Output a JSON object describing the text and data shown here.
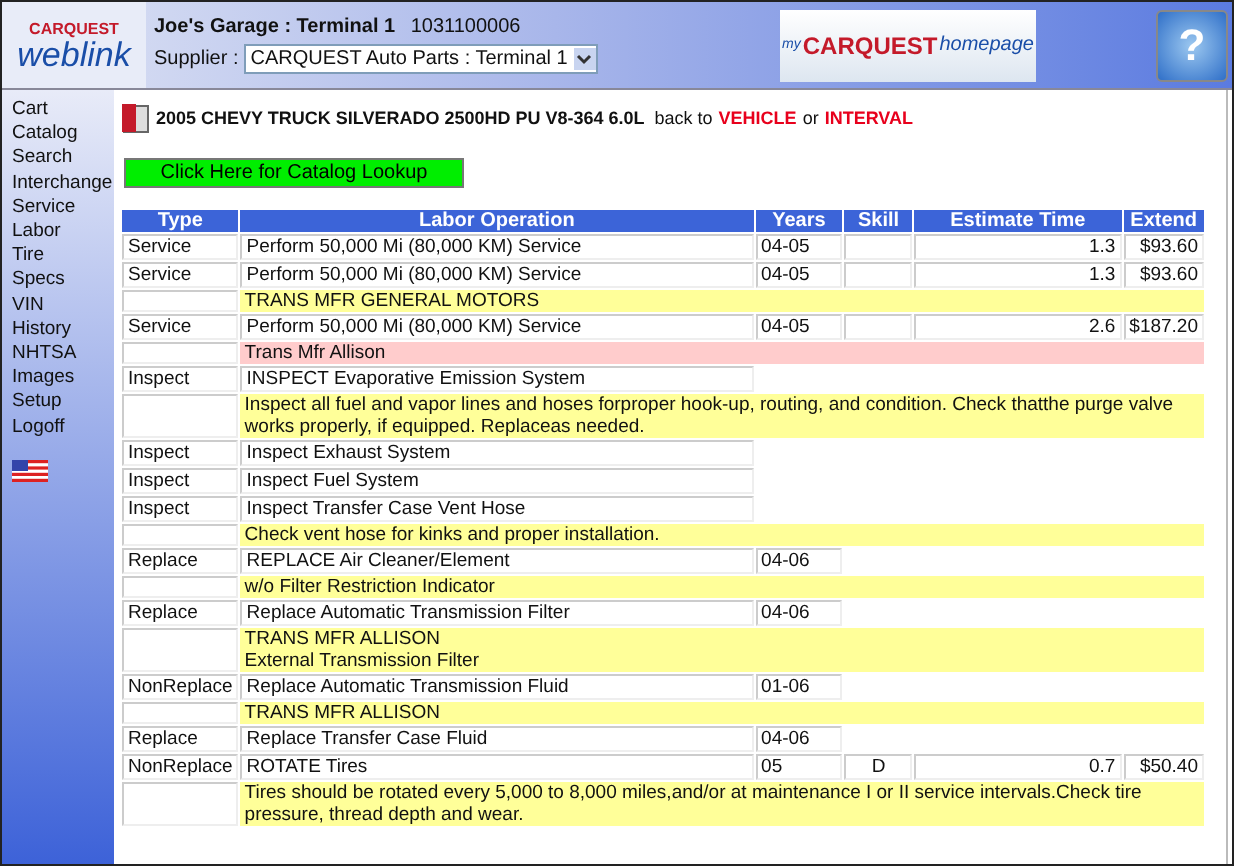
{
  "logo": {
    "top": "CARQUEST",
    "bottom": "weblink"
  },
  "header": {
    "garage": "Joe's Garage : Terminal 1",
    "account": "1031100006",
    "supplier_label": "Supplier :",
    "supplier_value": "CARQUEST Auto Parts : Terminal 1"
  },
  "banner": {
    "my": "my",
    "brand": "CARQUEST",
    "home": "homepage"
  },
  "help": {
    "glyph": "?"
  },
  "sidebar": {
    "items": [
      "Cart",
      "Catalog",
      "Search",
      "Interchange",
      "Service",
      "Labor",
      "Tire",
      "Specs",
      "VIN",
      "History",
      "NHTSA",
      "Images",
      "Setup",
      "Logoff"
    ]
  },
  "vehicle": {
    "title": "2005 CHEVY TRUCK SILVERADO 2500HD PU V8-364 6.0L",
    "back": "back to",
    "link1": "VEHICLE",
    "or": "or",
    "link2": "INTERVAL"
  },
  "catalog_button": "Click Here for Catalog Lookup",
  "table": {
    "columns": [
      "Type",
      "Labor Operation",
      "Years",
      "Skill",
      "Estimate Time",
      "Extend"
    ],
    "rows": [
      {
        "kind": "op",
        "type": "Service",
        "operation": "Perform 50,000 Mi (80,000 KM) Service",
        "years": "04-05",
        "estimate": "1.3",
        "extend": "$93.60"
      },
      {
        "kind": "op",
        "type": "Service",
        "operation": "Perform 50,000 Mi (80,000 KM) Service",
        "years": "04-05",
        "estimate": "1.3",
        "extend": "$93.60"
      },
      {
        "kind": "note",
        "color": "#ffff99",
        "text": "TRANS MFR GENERAL MOTORS"
      },
      {
        "kind": "op",
        "type": "Service",
        "operation": "Perform 50,000 Mi (80,000 KM) Service",
        "years": "04-05",
        "estimate": "2.6",
        "extend": "$187.20"
      },
      {
        "kind": "note",
        "color": "#ffcccc",
        "text": "Trans Mfr Allison"
      },
      {
        "kind": "op",
        "type": "Inspect",
        "operation": "INSPECT Evaporative Emission System"
      },
      {
        "kind": "note",
        "color": "#ffff99",
        "text": "Inspect all fuel and vapor lines and hoses forproper hook-up, routing, and condition. Check thatthe purge valve works properly, if equipped. Replaceas needed."
      },
      {
        "kind": "op",
        "type": "Inspect",
        "operation": "Inspect Exhaust System"
      },
      {
        "kind": "op",
        "type": "Inspect",
        "operation": "Inspect Fuel System"
      },
      {
        "kind": "op",
        "type": "Inspect",
        "operation": "Inspect Transfer Case Vent Hose"
      },
      {
        "kind": "note",
        "color": "#ffff99",
        "text": "Check vent hose for kinks and proper installation."
      },
      {
        "kind": "op",
        "type": "Replace",
        "operation": "REPLACE Air Cleaner/Element",
        "years": "04-06"
      },
      {
        "kind": "note",
        "color": "#ffff99",
        "text": "w/o Filter Restriction Indicator"
      },
      {
        "kind": "op",
        "type": "Replace",
        "operation": "Replace Automatic Transmission Filter",
        "years": "04-06"
      },
      {
        "kind": "note",
        "color": "#ffff99",
        "lines": [
          "TRANS MFR ALLISON",
          "External Transmission Filter"
        ]
      },
      {
        "kind": "op",
        "type": "NonReplace",
        "operation": "Replace Automatic Transmission Fluid",
        "years": "01-06"
      },
      {
        "kind": "note",
        "color": "#ffff99",
        "text": "TRANS MFR ALLISON"
      },
      {
        "kind": "op",
        "type": "Replace",
        "operation": "Replace Transfer Case Fluid",
        "years": "04-06"
      },
      {
        "kind": "op",
        "type": "NonReplace",
        "operation": "ROTATE Tires",
        "years": "05",
        "skill": "D",
        "estimate": "0.7",
        "extend": "$50.40"
      },
      {
        "kind": "note",
        "color": "#ffff99",
        "text": "Tires should be rotated every 5,000 to 8,000 miles,and/or at maintenance I or II service intervals.Check tire pressure, thread depth and wear."
      }
    ]
  }
}
